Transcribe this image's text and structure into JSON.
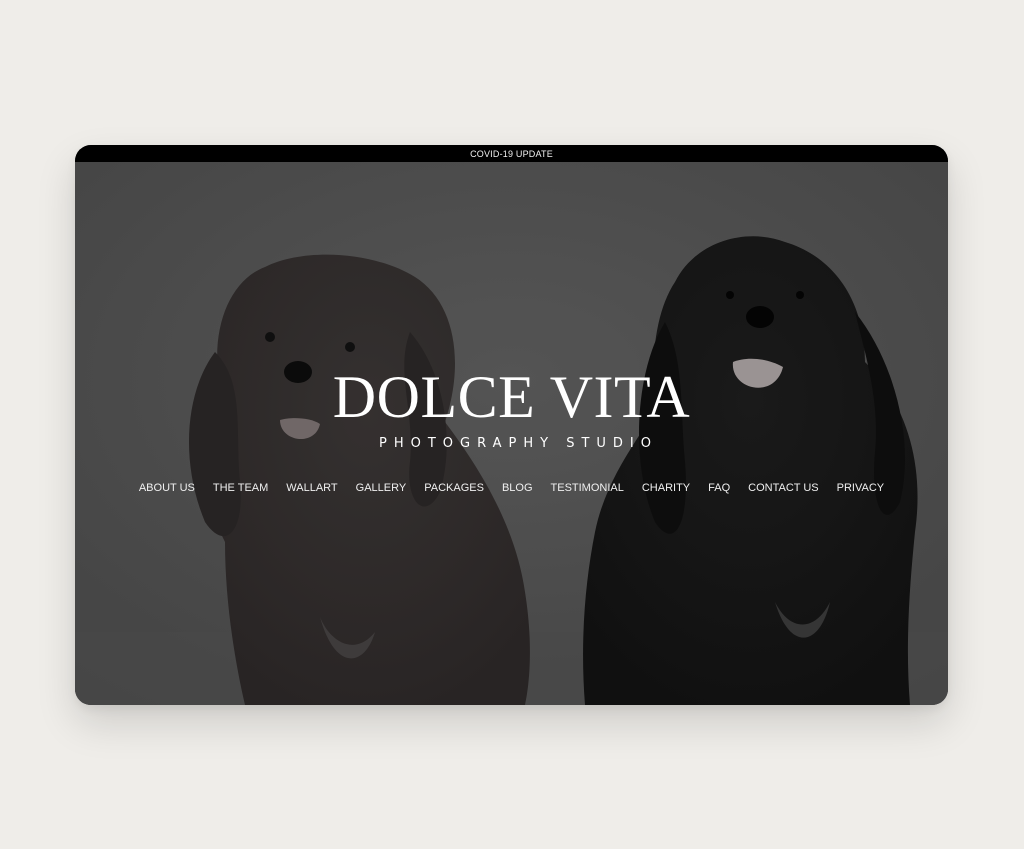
{
  "announcement": {
    "label": "COVID-19 UPDATE"
  },
  "hero": {
    "title": "DOLCE VITA",
    "subtitle": "PHOTOGRAPHY STUDIO"
  },
  "nav": {
    "items": [
      {
        "label": "ABOUT US"
      },
      {
        "label": "THE TEAM"
      },
      {
        "label": "WALLART"
      },
      {
        "label": "GALLERY"
      },
      {
        "label": "PACKAGES"
      },
      {
        "label": "BLOG"
      },
      {
        "label": "TESTIMONIAL"
      },
      {
        "label": "CHARITY"
      },
      {
        "label": "FAQ"
      },
      {
        "label": "CONTACT US"
      },
      {
        "label": "PRIVACY"
      }
    ]
  },
  "colors": {
    "page_background": "#efede9",
    "announcement_bar": "#000000",
    "hero_overlay": "#4a4a4a",
    "text": "#ffffff"
  }
}
